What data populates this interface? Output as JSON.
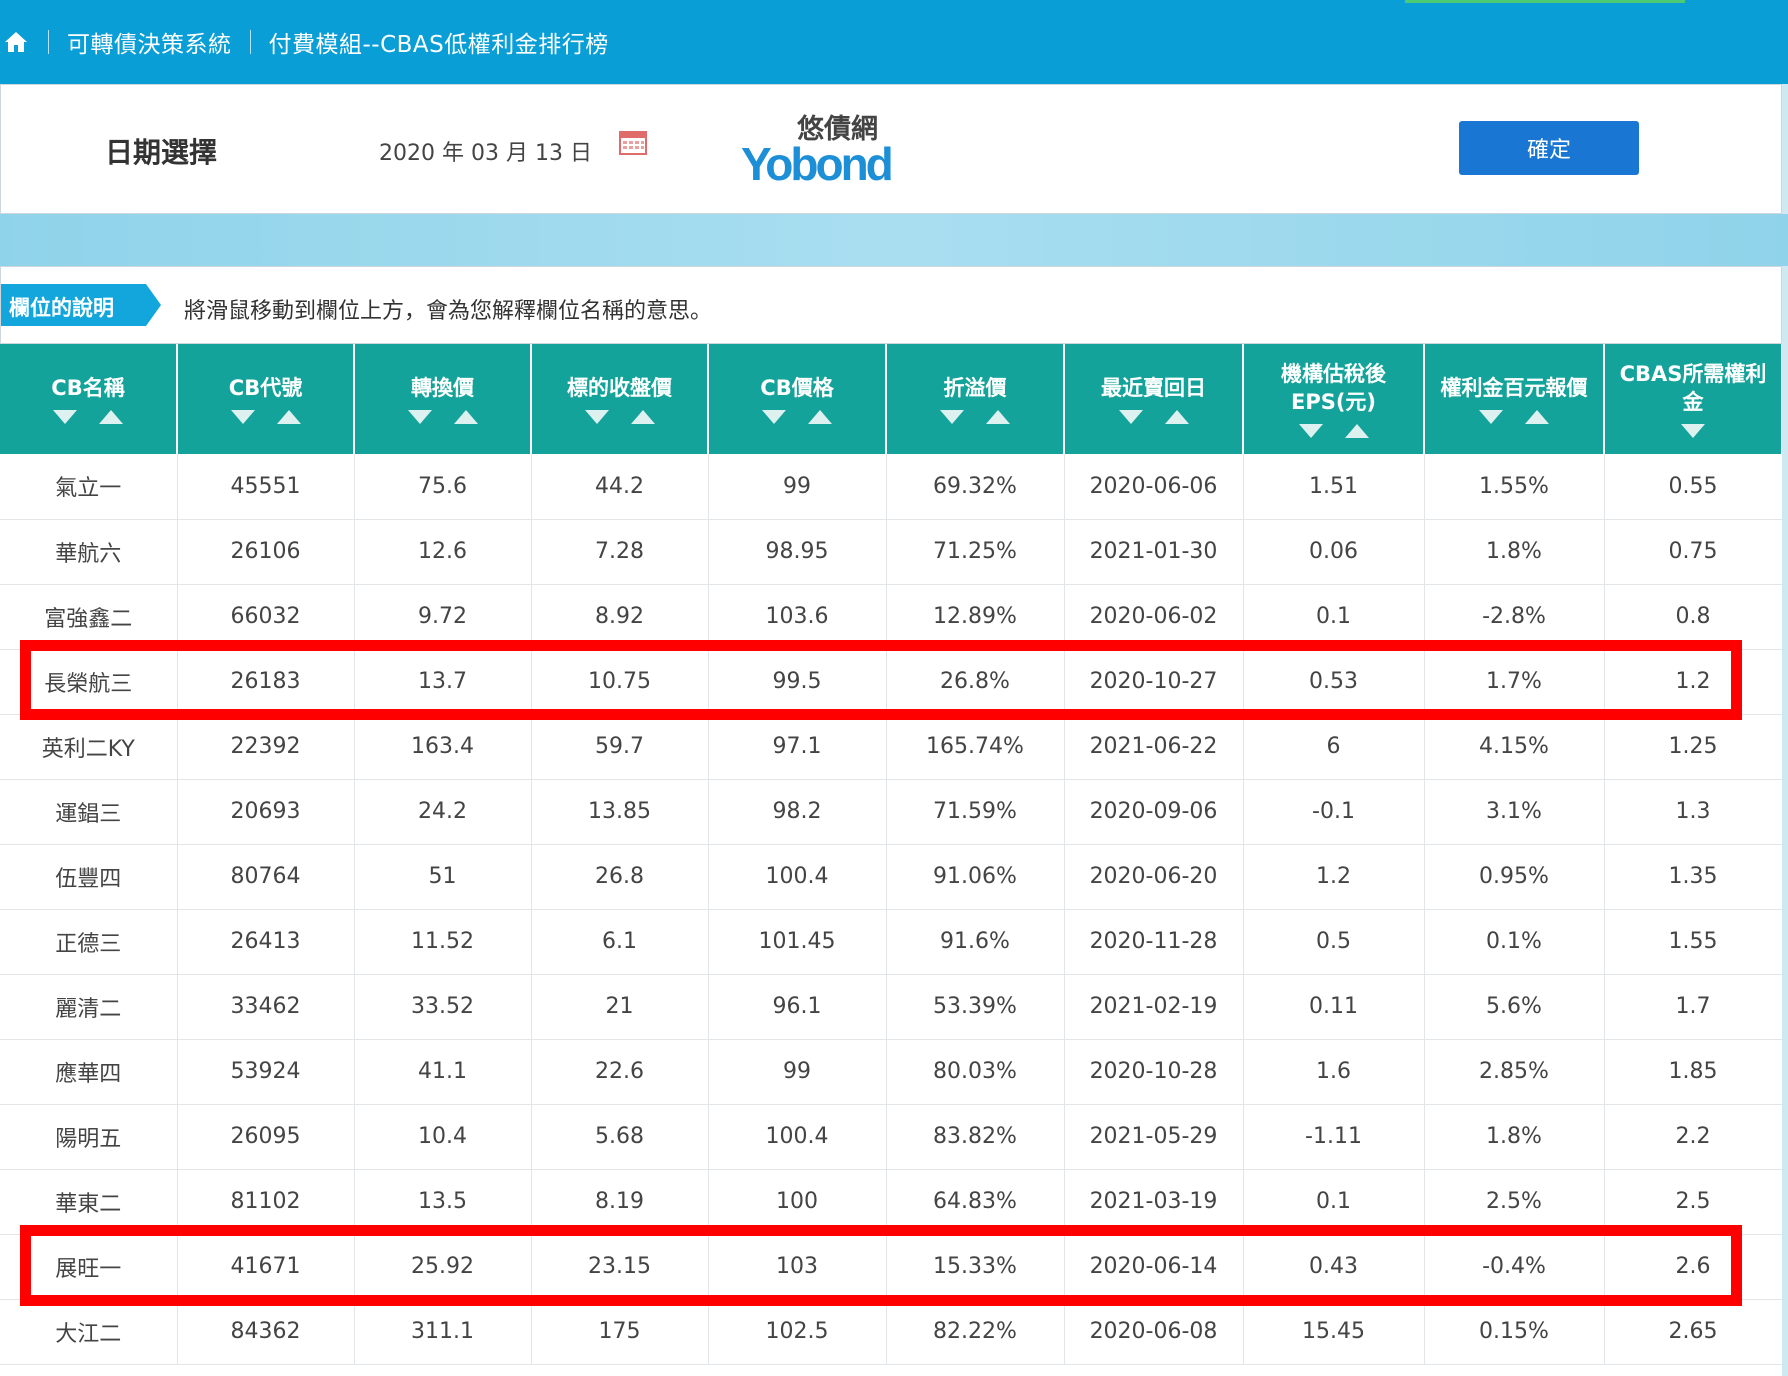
{
  "breadcrumb": {
    "home_icon": "home-icon",
    "items": [
      "可轉債決策系統",
      "付費模組--CBAS低權利金排行榜"
    ]
  },
  "date_panel": {
    "label": "日期選擇",
    "year": "2020",
    "year_unit": "年",
    "month": "03",
    "month_unit": "月",
    "day": "13",
    "day_unit": "日",
    "calendar_icon": "calendar-icon",
    "logo_top": "悠債網",
    "logo_bottom": "Yobond",
    "confirm_label": "確定"
  },
  "explain": {
    "tag": "欄位的說明",
    "text": "將滑鼠移動到欄位上方，會為您解釋欄位名稱的意思。"
  },
  "table": {
    "headers": [
      {
        "label": "CB名稱",
        "sort": "both"
      },
      {
        "label": "CB代號",
        "sort": "both"
      },
      {
        "label": "轉換價",
        "sort": "both"
      },
      {
        "label": "標的收盤價",
        "sort": "both"
      },
      {
        "label": "CB價格",
        "sort": "both"
      },
      {
        "label": "折溢價",
        "sort": "both"
      },
      {
        "label": "最近賣回日",
        "sort": "both"
      },
      {
        "label": "機構估稅後EPS(元)",
        "sort": "both"
      },
      {
        "label": "權利金百元報價",
        "sort": "both"
      },
      {
        "label": "CBAS所需權利金",
        "sort": "down"
      }
    ],
    "rows": [
      [
        "氣立一",
        "45551",
        "75.6",
        "44.2",
        "99",
        "69.32%",
        "2020-06-06",
        "1.51",
        "1.55%",
        "0.55"
      ],
      [
        "華航六",
        "26106",
        "12.6",
        "7.28",
        "98.95",
        "71.25%",
        "2021-01-30",
        "0.06",
        "1.8%",
        "0.75"
      ],
      [
        "富強鑫二",
        "66032",
        "9.72",
        "8.92",
        "103.6",
        "12.89%",
        "2020-06-02",
        "0.1",
        "-2.8%",
        "0.8"
      ],
      [
        "長榮航三",
        "26183",
        "13.7",
        "10.75",
        "99.5",
        "26.8%",
        "2020-10-27",
        "0.53",
        "1.7%",
        "1.2"
      ],
      [
        "英利二KY",
        "22392",
        "163.4",
        "59.7",
        "97.1",
        "165.74%",
        "2021-06-22",
        "6",
        "4.15%",
        "1.25"
      ],
      [
        "運錩三",
        "20693",
        "24.2",
        "13.85",
        "98.2",
        "71.59%",
        "2020-09-06",
        "-0.1",
        "3.1%",
        "1.3"
      ],
      [
        "伍豐四",
        "80764",
        "51",
        "26.8",
        "100.4",
        "91.06%",
        "2020-06-20",
        "1.2",
        "0.95%",
        "1.35"
      ],
      [
        "正德三",
        "26413",
        "11.52",
        "6.1",
        "101.45",
        "91.6%",
        "2020-11-28",
        "0.5",
        "0.1%",
        "1.55"
      ],
      [
        "麗清二",
        "33462",
        "33.52",
        "21",
        "96.1",
        "53.39%",
        "2021-02-19",
        "0.11",
        "5.6%",
        "1.7"
      ],
      [
        "應華四",
        "53924",
        "41.1",
        "22.6",
        "99",
        "80.03%",
        "2020-10-28",
        "1.6",
        "2.85%",
        "1.85"
      ],
      [
        "陽明五",
        "26095",
        "10.4",
        "5.68",
        "100.4",
        "83.82%",
        "2021-05-29",
        "-1.11",
        "1.8%",
        "2.2"
      ],
      [
        "華東二",
        "81102",
        "13.5",
        "8.19",
        "100",
        "64.83%",
        "2021-03-19",
        "0.1",
        "2.5%",
        "2.5"
      ],
      [
        "展旺一",
        "41671",
        "25.92",
        "23.15",
        "103",
        "15.33%",
        "2020-06-14",
        "0.43",
        "-0.4%",
        "2.6"
      ],
      [
        "大江二",
        "84362",
        "311.1",
        "175",
        "102.5",
        "82.22%",
        "2020-06-08",
        "15.45",
        "0.15%",
        "2.65"
      ]
    ]
  },
  "highlight_color": "#ff0000",
  "header_color": "#14a39a",
  "topbar_color": "#0a9ed6"
}
